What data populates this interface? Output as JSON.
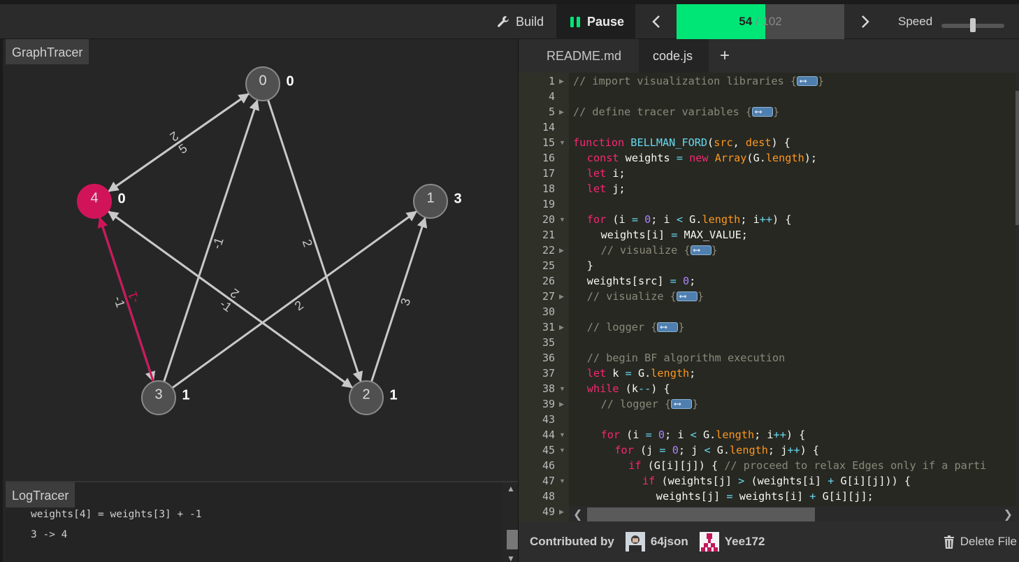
{
  "toolbar": {
    "build_label": "Build",
    "pause_label": "Pause",
    "progress_current": "54",
    "progress_sep": " / ",
    "progress_total": "102",
    "progress_fraction": 0.53,
    "speed_label": "Speed",
    "speed_value": 0.5,
    "icons": [
      "wrench-icon",
      "pause-icon",
      "chevron-left-icon",
      "chevron-right-icon"
    ]
  },
  "graph_tracer": {
    "title": "GraphTracer",
    "nodes": [
      {
        "id": "0",
        "weight": "0"
      },
      {
        "id": "1",
        "weight": "3"
      },
      {
        "id": "2",
        "weight": "1"
      },
      {
        "id": "3",
        "weight": "1"
      },
      {
        "id": "4",
        "weight": "0",
        "selected": true
      }
    ],
    "edges": [
      {
        "from": "0",
        "to": "4",
        "weight": "2"
      },
      {
        "from": "4",
        "to": "0",
        "weight": "5"
      },
      {
        "from": "0",
        "to": "2",
        "weight": "2"
      },
      {
        "from": "3",
        "to": "0",
        "weight": "-1"
      },
      {
        "from": "3",
        "to": "1",
        "weight": "2"
      },
      {
        "from": "2",
        "to": "1",
        "weight": "3"
      },
      {
        "from": "4",
        "to": "2",
        "weight": "-1"
      },
      {
        "from": "2",
        "to": "4",
        "weight": "2"
      },
      {
        "from": "4",
        "to": "3",
        "weight": "-1"
      },
      {
        "from": "3",
        "to": "4",
        "weight": "-1",
        "highlighted": true
      }
    ],
    "colors": {
      "node": "#505050",
      "selected": "#d1145a",
      "edge": "#c8c8c8",
      "highlight_edge": "#d1145a"
    }
  },
  "log_tracer": {
    "title": "LogTracer",
    "lines": [
      "weights[4] = weights[3] + -1",
      "3 -> 4"
    ]
  },
  "editor": {
    "tabs": [
      "README.md",
      "code.js"
    ],
    "active_tab": "code.js",
    "add_tab": "+",
    "lines": [
      {
        "n": "1",
        "fold": "right",
        "indent": 0,
        "tokens": [
          [
            "c-com",
            "// import visualization libraries {"
          ],
          [
            "w",
            ""
          ],
          [
            "c-com",
            "}"
          ]
        ]
      },
      {
        "n": "4",
        "indent": 0,
        "tokens": []
      },
      {
        "n": "5",
        "fold": "right",
        "indent": 0,
        "tokens": [
          [
            "c-com",
            "// define tracer variables {"
          ],
          [
            "w",
            ""
          ],
          [
            "c-com",
            "}"
          ]
        ]
      },
      {
        "n": "14",
        "indent": 0,
        "tokens": []
      },
      {
        "n": "15",
        "fold": "down",
        "indent": 0,
        "tokens": [
          [
            "c-kw",
            "function "
          ],
          [
            "c-fn",
            "BELLMAN_FORD"
          ],
          [
            "",
            "("
          ],
          [
            "c-par",
            "src"
          ],
          [
            "",
            ", "
          ],
          [
            "c-par",
            "dest"
          ],
          [
            "",
            ") {"
          ]
        ]
      },
      {
        "n": "16",
        "indent": 1,
        "tokens": [
          [
            "c-kw",
            "const "
          ],
          [
            "",
            "weights "
          ],
          [
            "c-op",
            "= "
          ],
          [
            "c-kw",
            "new "
          ],
          [
            "c-prop",
            "Array"
          ],
          [
            "",
            "(G."
          ],
          [
            "c-prop",
            "length"
          ],
          [
            "",
            ");"
          ]
        ]
      },
      {
        "n": "17",
        "indent": 1,
        "tokens": [
          [
            "c-kw",
            "let "
          ],
          [
            "",
            "i;"
          ]
        ]
      },
      {
        "n": "18",
        "indent": 1,
        "tokens": [
          [
            "c-kw",
            "let "
          ],
          [
            "",
            "j;"
          ]
        ]
      },
      {
        "n": "19",
        "indent": 0,
        "tokens": []
      },
      {
        "n": "20",
        "fold": "down",
        "indent": 1,
        "tokens": [
          [
            "c-kw",
            "for "
          ],
          [
            "",
            "(i "
          ],
          [
            "c-op",
            "= "
          ],
          [
            "c-num",
            "0"
          ],
          [
            "",
            "; i "
          ],
          [
            "c-op",
            "< "
          ],
          [
            "",
            "G."
          ],
          [
            "c-prop",
            "length"
          ],
          [
            "",
            "; i"
          ],
          [
            "c-op",
            "++"
          ],
          [
            "",
            ") {"
          ]
        ]
      },
      {
        "n": "21",
        "indent": 2,
        "tokens": [
          [
            "",
            "weights[i] "
          ],
          [
            "c-op",
            "= "
          ],
          [
            "",
            "MAX_VALUE;"
          ]
        ]
      },
      {
        "n": "22",
        "fold": "right",
        "indent": 2,
        "tokens": [
          [
            "c-com",
            "// visualize {"
          ],
          [
            "w",
            ""
          ],
          [
            "c-com",
            "}"
          ]
        ]
      },
      {
        "n": "25",
        "indent": 1,
        "tokens": [
          [
            "",
            "}"
          ]
        ]
      },
      {
        "n": "26",
        "indent": 1,
        "tokens": [
          [
            "",
            "weights[src] "
          ],
          [
            "c-op",
            "= "
          ],
          [
            "c-num",
            "0"
          ],
          [
            "",
            ";"
          ]
        ]
      },
      {
        "n": "27",
        "fold": "right",
        "indent": 1,
        "tokens": [
          [
            "c-com",
            "// visualize {"
          ],
          [
            "w",
            ""
          ],
          [
            "c-com",
            "}"
          ]
        ]
      },
      {
        "n": "30",
        "indent": 0,
        "tokens": []
      },
      {
        "n": "31",
        "fold": "right",
        "indent": 1,
        "tokens": [
          [
            "c-com",
            "// logger {"
          ],
          [
            "w",
            ""
          ],
          [
            "c-com",
            "}"
          ]
        ]
      },
      {
        "n": "35",
        "indent": 0,
        "tokens": []
      },
      {
        "n": "36",
        "indent": 1,
        "tokens": [
          [
            "c-com",
            "// begin BF algorithm execution"
          ]
        ]
      },
      {
        "n": "37",
        "indent": 1,
        "tokens": [
          [
            "c-kw",
            "let "
          ],
          [
            "",
            "k "
          ],
          [
            "c-op",
            "= "
          ],
          [
            "",
            "G."
          ],
          [
            "c-prop",
            "length"
          ],
          [
            "",
            ";"
          ]
        ]
      },
      {
        "n": "38",
        "fold": "down",
        "indent": 1,
        "tokens": [
          [
            "c-kw",
            "while "
          ],
          [
            "",
            "(k"
          ],
          [
            "c-op",
            "--"
          ],
          [
            "",
            ") {"
          ]
        ]
      },
      {
        "n": "39",
        "fold": "right",
        "indent": 2,
        "tokens": [
          [
            "c-com",
            "// logger {"
          ],
          [
            "w",
            ""
          ],
          [
            "c-com",
            "}"
          ]
        ]
      },
      {
        "n": "43",
        "indent": 0,
        "tokens": []
      },
      {
        "n": "44",
        "fold": "down",
        "indent": 2,
        "tokens": [
          [
            "c-kw",
            "for "
          ],
          [
            "",
            "(i "
          ],
          [
            "c-op",
            "= "
          ],
          [
            "c-num",
            "0"
          ],
          [
            "",
            "; i "
          ],
          [
            "c-op",
            "< "
          ],
          [
            "",
            "G."
          ],
          [
            "c-prop",
            "length"
          ],
          [
            "",
            "; i"
          ],
          [
            "c-op",
            "++"
          ],
          [
            "",
            ") {"
          ]
        ]
      },
      {
        "n": "45",
        "fold": "down",
        "indent": 3,
        "tokens": [
          [
            "c-kw",
            "for "
          ],
          [
            "",
            "(j "
          ],
          [
            "c-op",
            "= "
          ],
          [
            "c-num",
            "0"
          ],
          [
            "",
            "; j "
          ],
          [
            "c-op",
            "< "
          ],
          [
            "",
            "G."
          ],
          [
            "c-prop",
            "length"
          ],
          [
            "",
            "; j"
          ],
          [
            "c-op",
            "++"
          ],
          [
            "",
            ") {"
          ]
        ]
      },
      {
        "n": "46",
        "indent": 4,
        "tokens": [
          [
            "c-kw",
            "if "
          ],
          [
            "",
            "(G[i][j]) { "
          ],
          [
            "c-com",
            "// proceed to relax Edges only if a parti"
          ]
        ]
      },
      {
        "n": "47",
        "fold": "down",
        "indent": 5,
        "tokens": [
          [
            "c-kw",
            "if "
          ],
          [
            "",
            "(weights[j] "
          ],
          [
            "c-op",
            "> "
          ],
          [
            "",
            "(weights[i] "
          ],
          [
            "c-op",
            "+ "
          ],
          [
            "",
            "G[i][j])) {"
          ]
        ]
      },
      {
        "n": "48",
        "indent": 6,
        "tokens": [
          [
            "",
            "weights[j] "
          ],
          [
            "c-op",
            "= "
          ],
          [
            "",
            "weights[i] "
          ],
          [
            "c-op",
            "+ "
          ],
          [
            "",
            "G[i][j];"
          ]
        ]
      },
      {
        "n": "49",
        "fold": "right",
        "indent": 6,
        "tokens": []
      }
    ]
  },
  "footer": {
    "contributed_by": "Contributed by",
    "contributors": [
      "64json",
      "Yee172"
    ],
    "delete_label": "Delete File"
  }
}
